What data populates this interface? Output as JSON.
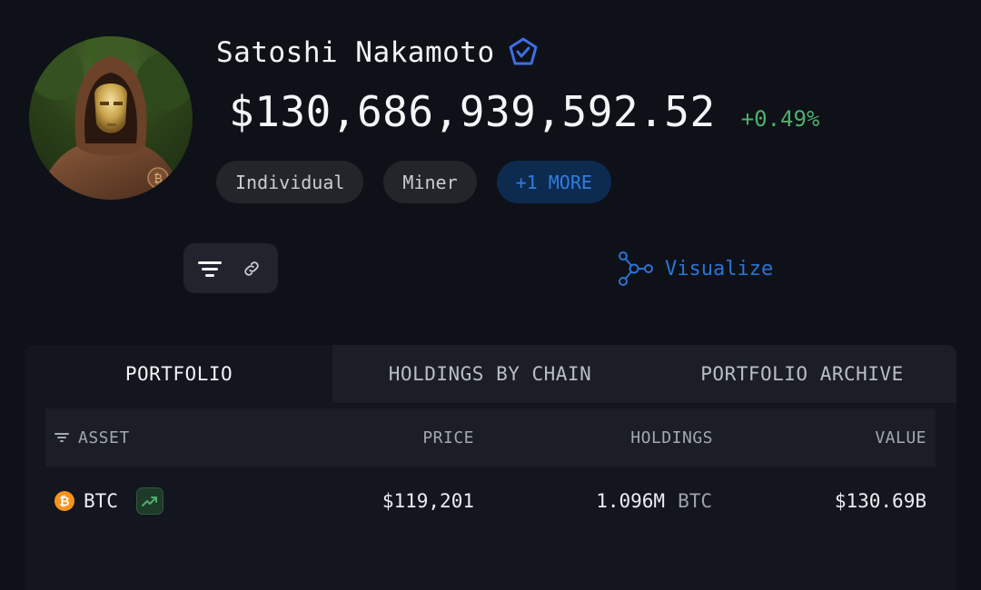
{
  "profile": {
    "name": "Satoshi Nakamoto",
    "total_value": "$130,686,939,592.52",
    "change": "+0.49%",
    "tags": [
      "Individual",
      "Miner",
      "+1 MORE"
    ]
  },
  "actions": {
    "visualize_label": "Visualize"
  },
  "tabs": [
    "PORTFOLIO",
    "HOLDINGS BY CHAIN",
    "PORTFOLIO ARCHIVE"
  ],
  "table": {
    "headers": {
      "asset": "ASSET",
      "price": "PRICE",
      "holdings": "HOLDINGS",
      "value": "VALUE"
    },
    "rows": [
      {
        "asset": "BTC",
        "price": "$119,201",
        "holdings": "1.096M",
        "holdings_unit": "BTC",
        "value": "$130.69B"
      }
    ]
  },
  "colors": {
    "positive": "#4fb06a",
    "accent": "#2a74d6",
    "verified_badge": "#3d6fe3",
    "btc": "#f7931a"
  }
}
